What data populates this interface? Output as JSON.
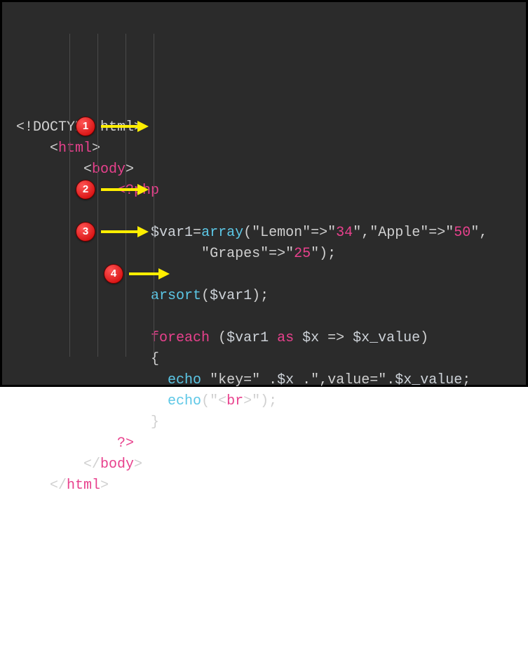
{
  "code": {
    "l1_doctype": "<!DOCTYPE html>",
    "l2_html_open_lt": "<",
    "l2_html_open_name": "html",
    "l2_html_open_gt": ">",
    "l3_body_open_lt": "<",
    "l3_body_open_name": "body",
    "l3_body_open_gt": ">",
    "l4_php_open": "<?php",
    "l5_var": "$var1",
    "l5_eq": "=",
    "l5_fn": "array",
    "l5_p1": "(",
    "l5_q1": "\"",
    "l5_k1": "Lemon",
    "l5_q2": "\"",
    "l5_arrow1": "=>",
    "l5_q3": "\"",
    "l5_v1": "34",
    "l5_q4": "\"",
    "l5_c1": ",",
    "l5_q5": "\"",
    "l5_k2": "Apple",
    "l5_q6": "\"",
    "l5_arrow2": "=>",
    "l5_q7": "\"",
    "l5_v2": "50",
    "l5_q8": "\"",
    "l5_c2": ",",
    "l6_q1": "\"",
    "l6_k": "Grapes",
    "l6_q2": "\"",
    "l6_arrow": "=>",
    "l6_q3": "\"",
    "l6_v": "25",
    "l6_q4": "\"",
    "l6_pc": ");",
    "l7_fn": "arsort",
    "l7_p": "(",
    "l7_var": "$var1",
    "l7_pc": ");",
    "l8_kw": "foreach",
    "l8_sp": " (",
    "l8_var": "$var1",
    "l8_as": " as ",
    "l8_x": "$x",
    "l8_ar": " => ",
    "l8_xv": "$x_value",
    "l8_cp": ")",
    "l9_brace": "{",
    "l10_echo": "echo",
    "l10_s1": " \"",
    "l10_key": "key=",
    "l10_q1": "\" ",
    "l10_d1": ".",
    "l10_x": "$x",
    "l10_sp": " ",
    "l10_d2": ".",
    "l10_q2": "\"",
    "l10_val": ",value=",
    "l10_q3": "\"",
    "l10_d3": ".",
    "l10_xv": "$x_value",
    "l10_sc": ";",
    "l11_echo": "echo",
    "l11_p": "(\"",
    "l11_lt": "<",
    "l11_br": "br",
    "l11_gt": ">",
    "l11_pc": "\");",
    "l12_brace": "}",
    "l13_php_close": "?>",
    "l14_body_close_lt": "</",
    "l14_body_close_name": "body",
    "l14_body_close_gt": ">",
    "l15_html_close_lt": "</",
    "l15_html_close_name": "html",
    "l15_html_close_gt": ">"
  },
  "annotations": {
    "b1": "1",
    "b2": "2",
    "b3": "3",
    "b4": "4"
  }
}
